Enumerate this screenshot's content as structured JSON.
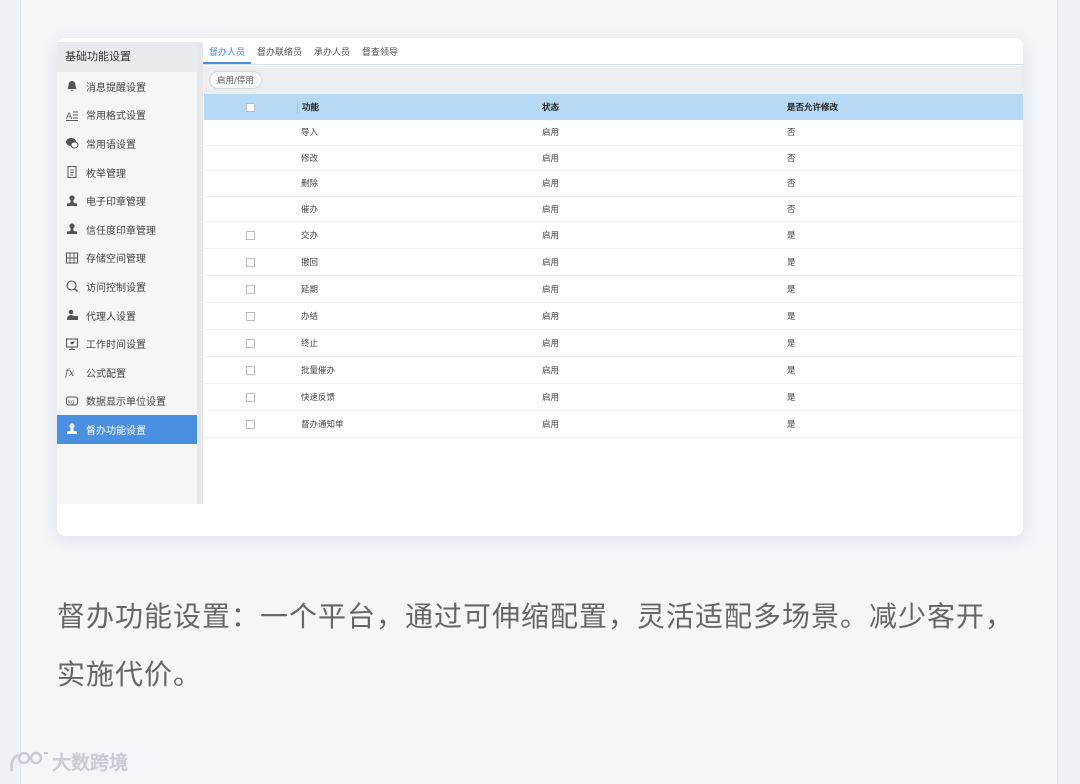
{
  "sidebar": {
    "title": "基础功能设置",
    "items": [
      {
        "label": "消息提醒设置",
        "icon": "bell-icon"
      },
      {
        "label": "常用格式设置",
        "icon": "format-icon"
      },
      {
        "label": "常用语设置",
        "icon": "chat-icon"
      },
      {
        "label": "枚举管理",
        "icon": "document-icon"
      },
      {
        "label": "电子印章管理",
        "icon": "stamp-icon"
      },
      {
        "label": "信任度印章管理",
        "icon": "stamp-icon"
      },
      {
        "label": "存储空间管理",
        "icon": "storage-icon"
      },
      {
        "label": "访问控制设置",
        "icon": "shield-icon"
      },
      {
        "label": "代理人设置",
        "icon": "agent-icon"
      },
      {
        "label": "工作时间设置",
        "icon": "monitor-icon"
      },
      {
        "label": "公式配置",
        "icon": "fx-icon"
      },
      {
        "label": "数据显示单位设置",
        "icon": "unit-icon"
      },
      {
        "label": "督办功能设置",
        "icon": "stamp-icon"
      }
    ],
    "active_index": 12
  },
  "tabs": [
    "督办人员",
    "督办联络员",
    "承办人员",
    "督查领导"
  ],
  "active_tab": 0,
  "toolbar": {
    "toggle_label": "启用/停用"
  },
  "table": {
    "headers": [
      "功能",
      "状态",
      "是否允许修改"
    ],
    "rows": [
      {
        "func": "导入",
        "status": "启用",
        "editable": "否",
        "checkbox": false
      },
      {
        "func": "修改",
        "status": "启用",
        "editable": "否",
        "checkbox": false
      },
      {
        "func": "删除",
        "status": "启用",
        "editable": "否",
        "checkbox": false
      },
      {
        "func": "催办",
        "status": "启用",
        "editable": "否",
        "checkbox": false
      },
      {
        "func": "交办",
        "status": "启用",
        "editable": "是",
        "checkbox": true
      },
      {
        "func": "撤回",
        "status": "启用",
        "editable": "是",
        "checkbox": true
      },
      {
        "func": "延期",
        "status": "启用",
        "editable": "是",
        "checkbox": true
      },
      {
        "func": "办结",
        "status": "启用",
        "editable": "是",
        "checkbox": true
      },
      {
        "func": "终止",
        "status": "启用",
        "editable": "是",
        "checkbox": true
      },
      {
        "func": "批量催办",
        "status": "启用",
        "editable": "是",
        "checkbox": true
      },
      {
        "func": "快速反馈",
        "status": "启用",
        "editable": "是",
        "checkbox": true
      },
      {
        "func": "督办通知单",
        "status": "启用",
        "editable": "是",
        "checkbox": true
      }
    ]
  },
  "caption": "督办功能设置：一个平台，通过可伸缩配置，灵活适配多场景。减少客开，实施代价。",
  "watermark": "大数跨境",
  "colors": {
    "accent": "#4a8fe0",
    "header": "#b6d9f5"
  }
}
